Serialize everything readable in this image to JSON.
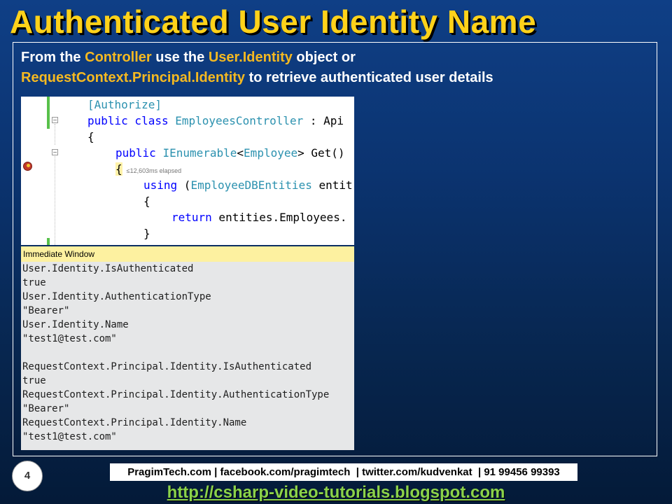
{
  "slide": {
    "title": "Authenticated User Identity Name",
    "number": "4"
  },
  "intro": {
    "part1": "From the ",
    "highlight1": "Controller",
    "part2": " use the ",
    "highlight2": "User.Identity",
    "part3": " object or",
    "highlight3": "RequestContext.Principal.Identity",
    "part4": " to retrieve authenticated user details"
  },
  "code": {
    "line1": "[Authorize]",
    "line2_kw": "public class ",
    "line2_ty": "EmployeesController",
    "line2_rest": " : Api",
    "line3": "{",
    "line4_kw": "public ",
    "line4_ty1": "IEnumerable",
    "line4_lt": "<",
    "line4_ty2": "Employee",
    "line4_rest": "> Get()",
    "line5_brace": "{",
    "line5_elapsed": "≤12,603ms elapsed",
    "line6_kw": "using",
    "line6_open": " (",
    "line6_ty": "EmployeeDBEntities",
    "line6_rest": " entit",
    "line7": "{",
    "line8_kw": "return",
    "line8_rest": " entities.Employees.",
    "line9": "}"
  },
  "immediate_window": {
    "title": "Immediate Window",
    "lines": [
      "User.Identity.IsAuthenticated",
      "true",
      "User.Identity.AuthenticationType",
      "\"Bearer\"",
      "User.Identity.Name",
      "\"test1@test.com\"",
      "",
      "RequestContext.Principal.Identity.IsAuthenticated",
      "true",
      "RequestContext.Principal.Identity.AuthenticationType",
      "\"Bearer\"",
      "RequestContext.Principal.Identity.Name",
      "\"test1@test.com\""
    ]
  },
  "footer": {
    "contact": "PragimTech.com | facebook.com/pragimtech  | twitter.com/kudvenkat  | 91 99456 99393",
    "url": "http://csharp-video-tutorials.blogspot.com"
  },
  "colors": {
    "title": "#ffd21a",
    "highlight": "#f5b921",
    "keyword": "#0000ff",
    "type": "#2b91af",
    "url": "#8bd24a"
  }
}
